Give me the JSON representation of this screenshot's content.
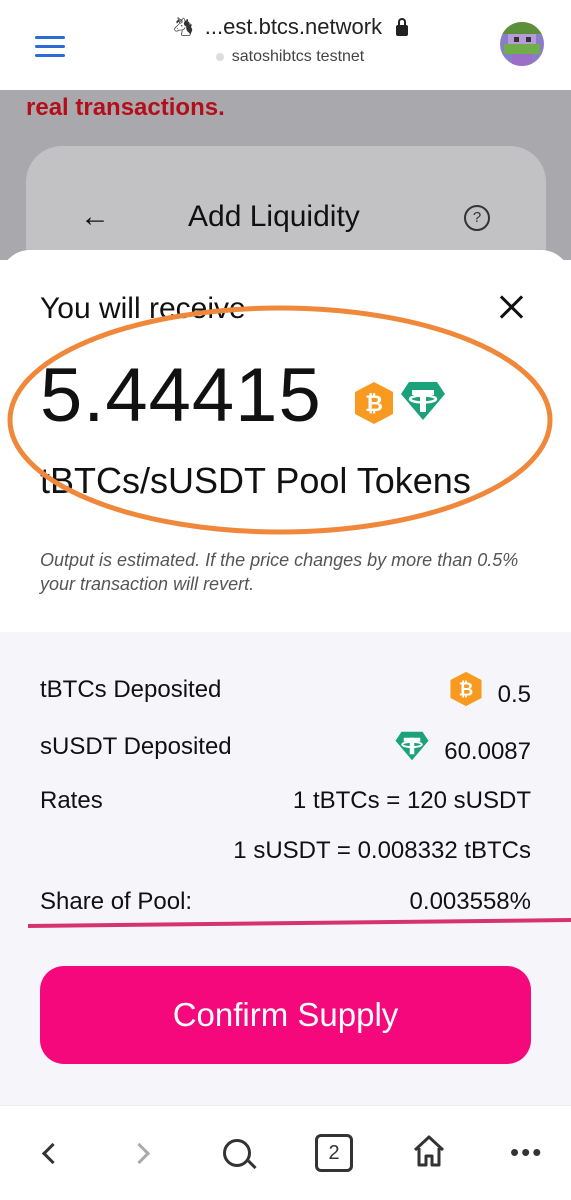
{
  "browser": {
    "url_display": "...est.btcs.network",
    "network_label": "satoshibtcs testnet",
    "tab_count": "2"
  },
  "background": {
    "warning_text": "real transactions.",
    "card_title": "Add Liquidity"
  },
  "modal": {
    "receive_label": "You will receive",
    "amount": "5.44415",
    "pool_tokens_label": "tBTCs/sUSDT Pool Tokens",
    "note": "Output is estimated. If the price changes by more than 0.5% your transaction will revert.",
    "details": {
      "tbtcs_label": "tBTCs Deposited",
      "tbtcs_value": "0.5",
      "susdt_label": "sUSDT Deposited",
      "susdt_value": "60.0087",
      "rates_label": "Rates",
      "rate_1": "1 tBTCs = 120 sUSDT",
      "rate_2": "1 sUSDT = 0.008332 tBTCs",
      "share_label": "Share of Pool:",
      "share_value": "0.003558%"
    },
    "confirm_label": "Confirm Supply"
  },
  "colors": {
    "accent": "#f5087c",
    "btc_orange": "#f79a1f",
    "usdt_teal": "#1ba27a",
    "annotation_orange": "#f0883c",
    "annotation_pink": "#d6336c",
    "warning_red": "#b30f1b"
  },
  "icons": [
    "hamburger-icon",
    "unicorn-icon",
    "lock-icon",
    "btc-token-icon",
    "usdt-token-icon",
    "close-icon",
    "back-arrow-icon",
    "help-icon",
    "nav-back-icon",
    "nav-forward-icon",
    "search-icon",
    "tabs-icon",
    "home-icon",
    "more-icon"
  ]
}
